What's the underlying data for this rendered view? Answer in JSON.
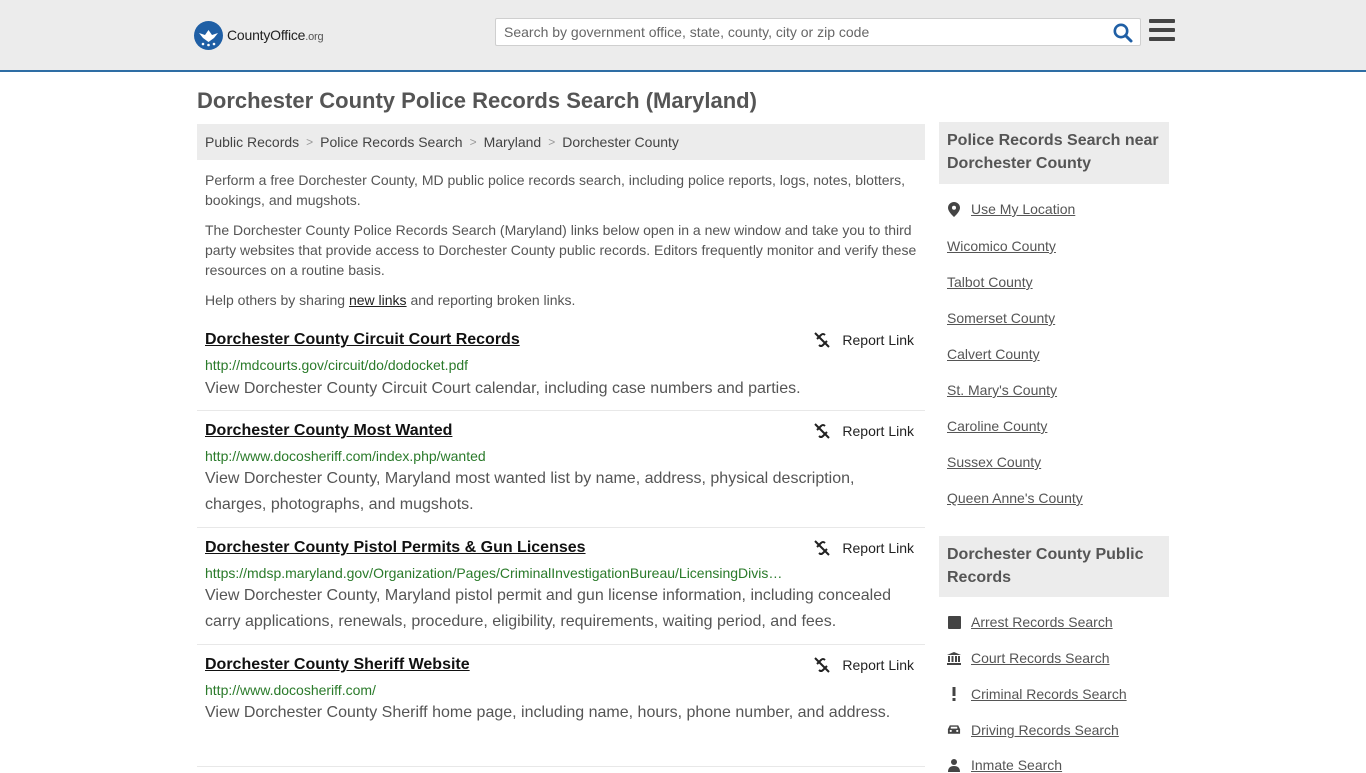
{
  "header": {
    "logo_name": "CountyOffice",
    "logo_tld": ".org",
    "search_placeholder": "Search by government office, state, county, city or zip code"
  },
  "page_title": "Dorchester County Police Records Search (Maryland)",
  "breadcrumb": [
    "Public Records",
    "Police Records Search",
    "Maryland",
    "Dorchester County"
  ],
  "intro": {
    "p1": "Perform a free Dorchester County, MD public police records search, including police reports, logs, notes, blotters, bookings, and mugshots.",
    "p2": "The Dorchester County Police Records Search (Maryland) links below open in a new window and take you to third party websites that provide access to Dorchester County public records. Editors frequently monitor and verify these resources on a routine basis.",
    "p3_before": "Help others by sharing ",
    "p3_link": "new links",
    "p3_after": " and reporting broken links."
  },
  "report_label": "Report Link",
  "results": [
    {
      "title": "Dorchester County Circuit Court Records",
      "url": "http://mdcourts.gov/circuit/do/dodocket.pdf",
      "desc": "View Dorchester County Circuit Court calendar, including case numbers and parties."
    },
    {
      "title": "Dorchester County Most Wanted",
      "url": "http://www.docosheriff.com/index.php/wanted",
      "desc": "View Dorchester County, Maryland most wanted list by name, address, physical description, charges, photographs, and mugshots."
    },
    {
      "title": "Dorchester County Pistol Permits & Gun Licenses",
      "url": "https://mdsp.maryland.gov/Organization/Pages/CriminalInvestigationBureau/LicensingDivis…",
      "desc": "View Dorchester County, Maryland pistol permit and gun license information, including concealed carry applications, renewals, procedure, eligibility, requirements, waiting period, and fees."
    },
    {
      "title": "Dorchester County Sheriff Website",
      "url": "http://www.docosheriff.com/",
      "desc": "View Dorchester County Sheriff home page, including name, hours, phone number, and address."
    }
  ],
  "sidebar": {
    "nearby_heading": "Police Records Search near Dorchester County",
    "use_location": "Use My Location",
    "nearby": [
      "Wicomico County",
      "Talbot County",
      "Somerset County",
      "Calvert County",
      "St. Mary's County",
      "Caroline County",
      "Sussex County",
      "Queen Anne's County"
    ],
    "public_heading": "Dorchester County Public Records",
    "public_links": [
      {
        "label": "Arrest Records Search",
        "icon": "square-icon"
      },
      {
        "label": "Court Records Search",
        "icon": "courthouse-icon"
      },
      {
        "label": "Criminal Records Search",
        "icon": "exclamation-icon"
      },
      {
        "label": "Driving Records Search",
        "icon": "car-icon"
      },
      {
        "label": "Inmate Search",
        "icon": "inmate-icon"
      }
    ]
  }
}
